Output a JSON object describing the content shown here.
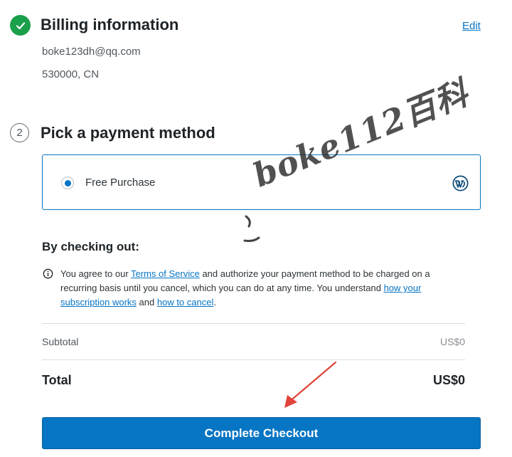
{
  "billing": {
    "title": "Billing information",
    "edit_label": "Edit",
    "email": "boke123dh@qq.com",
    "location": "530000, CN"
  },
  "payment": {
    "step_number": "2",
    "title": "Pick a payment method",
    "option_label": "Free Purchase",
    "option_selected": true
  },
  "terms": {
    "heading": "By checking out:",
    "text_1": "You agree to our ",
    "link_tos": "Terms of Service",
    "text_2": " and authorize your payment method to be charged on a recurring basis until you cancel, which you can do at any time. You understand ",
    "link_subscription": "how your subscription works",
    "text_3": " and ",
    "link_cancel": "how to cancel",
    "text_4": "."
  },
  "summary": {
    "subtotal_label": "Subtotal",
    "subtotal_value": "US$0",
    "total_label": "Total",
    "total_value": "US$0"
  },
  "checkout_button_label": "Complete Checkout",
  "watermark_text": "boke112百科",
  "colors": {
    "accent": "#0675c4",
    "success": "#1aa04a",
    "annotation_arrow": "#e0443a"
  }
}
